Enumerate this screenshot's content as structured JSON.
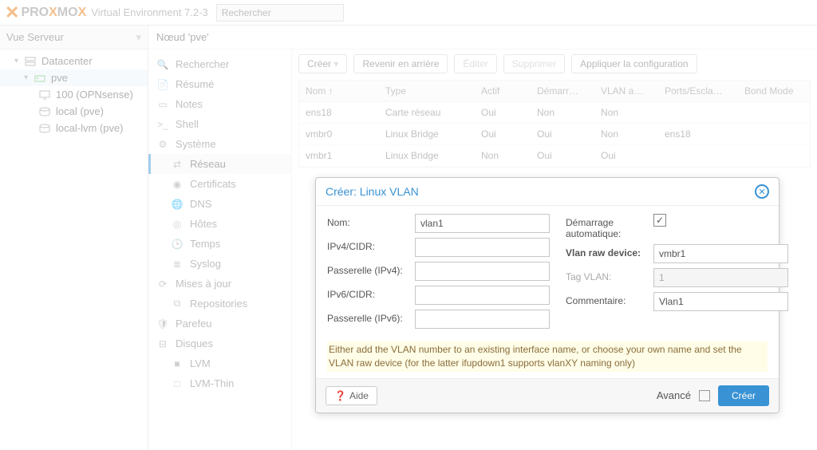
{
  "header": {
    "brand_pro": "PRO",
    "brand_x": "X",
    "brand_mo": "MO",
    "brand_x2": "X",
    "env": "Virtual Environment 7.2-3",
    "search_placeholder": "Rechercher"
  },
  "view_selector": "Vue Serveur",
  "tree": {
    "datacenter": "Datacenter",
    "node": "pve",
    "vm": "100 (OPNsense)",
    "local": "local (pve)",
    "local_lvm": "local-lvm (pve)"
  },
  "breadcrumb": "Nœud 'pve'",
  "sidemenu": {
    "search": "Rechercher",
    "summary": "Résumé",
    "notes": "Notes",
    "shell": "Shell",
    "system": "Système",
    "network": "Réseau",
    "certs": "Certificats",
    "dns": "DNS",
    "hosts": "Hôtes",
    "time": "Temps",
    "syslog": "Syslog",
    "updates": "Mises à jour",
    "repos": "Repositories",
    "firewall": "Parefeu",
    "disks": "Disques",
    "lvm": "LVM",
    "lvmthin": "LVM-Thin"
  },
  "toolbar": {
    "create": "Créer",
    "revert": "Revenir en arrière",
    "edit": "Éditer",
    "delete": "Supprimer",
    "apply": "Appliquer la configuration"
  },
  "columns": {
    "name": "Nom ↑",
    "type": "Type",
    "active": "Actif",
    "autostart": "Démarr…",
    "vlan": "VLAN a…",
    "ports": "Ports/Escla…",
    "bond": "Bond Mode"
  },
  "rows": [
    {
      "name": "ens18",
      "type": "Carte réseau",
      "active": "Oui",
      "autostart": "Non",
      "vlan": "Non",
      "ports": ""
    },
    {
      "name": "vmbr0",
      "type": "Linux Bridge",
      "active": "Oui",
      "autostart": "Oui",
      "vlan": "Non",
      "ports": "ens18"
    },
    {
      "name": "vmbr1",
      "type": "Linux Bridge",
      "active": "Non",
      "autostart": "Oui",
      "vlan": "Oui",
      "ports": ""
    }
  ],
  "dialog": {
    "title": "Créer: Linux VLAN",
    "labels": {
      "name": "Nom:",
      "ipv4": "IPv4/CIDR:",
      "gw4": "Passerelle (IPv4):",
      "ipv6": "IPv6/CIDR:",
      "gw6": "Passerelle (IPv6):",
      "autostart": "Démarrage automatique:",
      "rawdev": "Vlan raw device:",
      "tag": "Tag VLAN:",
      "comment": "Commentaire:"
    },
    "values": {
      "name": "vlan1",
      "rawdev": "vmbr1",
      "tag": "1",
      "comment": "Vlan1"
    },
    "hint": "Either add the VLAN number to an existing interface name, or choose your own name and set the VLAN raw device (for the latter ifupdown1 supports vlanXY naming only)",
    "help": "Aide",
    "advanced": "Avancé",
    "submit": "Créer"
  }
}
